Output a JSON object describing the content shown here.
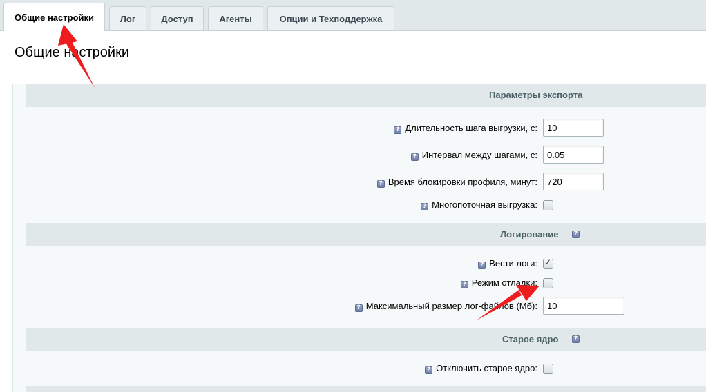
{
  "tabs": [
    {
      "label": "Общие настройки",
      "active": true
    },
    {
      "label": "Лог",
      "active": false
    },
    {
      "label": "Доступ",
      "active": false
    },
    {
      "label": "Агенты",
      "active": false
    },
    {
      "label": "Опции и Техподдержка",
      "active": false
    }
  ],
  "page_title": "Общие настройки",
  "sections": {
    "export": {
      "title": "Параметры экспорта",
      "step_duration": {
        "label": "Длительность шага выгрузки, с:",
        "value": "10"
      },
      "step_interval": {
        "label": "Интервал между шагами, с:",
        "value": "0.05"
      },
      "lock_time": {
        "label": "Время блокировки профиля, минут:",
        "value": "720"
      },
      "multithread": {
        "label": "Многопоточная выгрузка:",
        "checked": false
      }
    },
    "logging": {
      "title": "Логирование",
      "keep_logs": {
        "label": "Вести логи:",
        "checked": true
      },
      "debug_mode": {
        "label": "Режим отладки:",
        "checked": false
      },
      "max_log_size": {
        "label": "Максимальный размер лог-файлов (Мб):",
        "value": "10"
      }
    },
    "old_core": {
      "title": "Старое ядро",
      "disable_old_core": {
        "label": "Отключить старое ядро:",
        "checked": false
      }
    }
  },
  "colors": {
    "annotation_arrow": "#ee1c1c",
    "section_header_bg": "#e0e8ea",
    "section_header_text": "#4b6267"
  },
  "icons": [
    "help-icon",
    "checkbox-tick-icon",
    "annotation-arrow"
  ]
}
